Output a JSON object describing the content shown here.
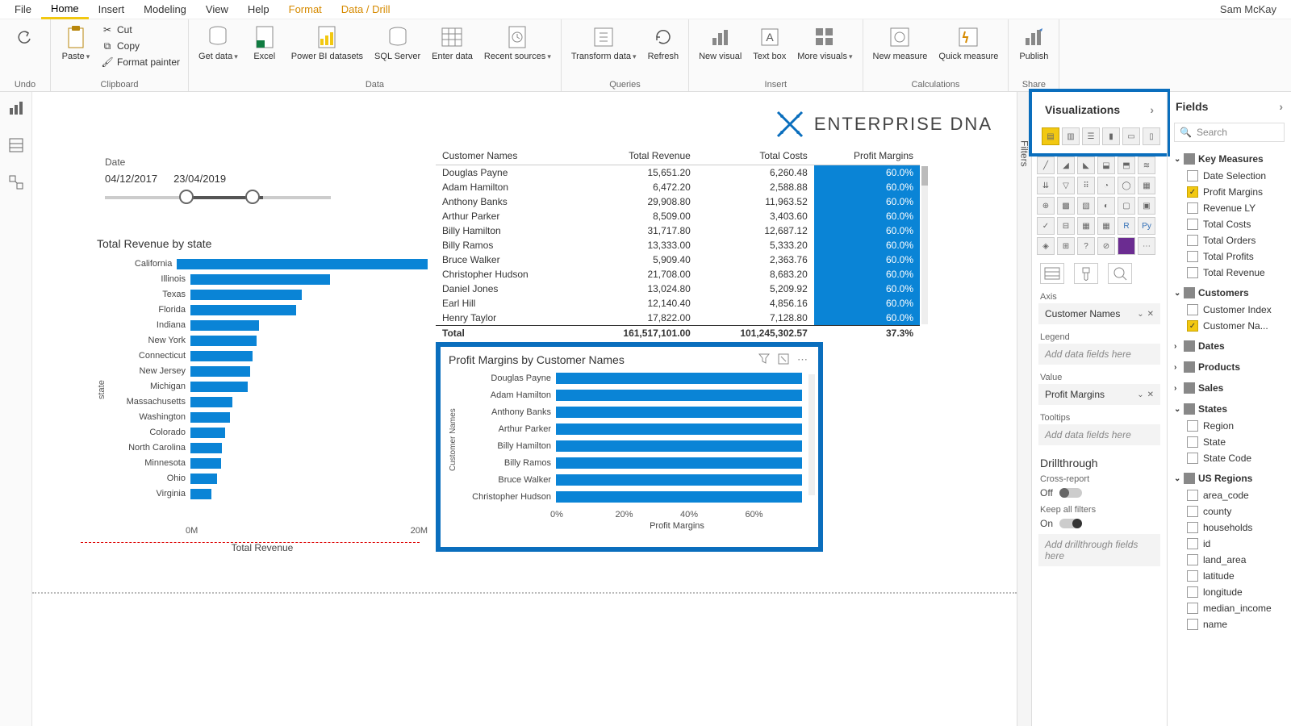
{
  "user": "Sam McKay",
  "menus": {
    "file": "File",
    "home": "Home",
    "insert": "Insert",
    "modeling": "Modeling",
    "view": "View",
    "help": "Help",
    "format": "Format",
    "datadrill": "Data / Drill"
  },
  "ribbon": {
    "undo": "Undo",
    "clipboard": {
      "paste": "Paste",
      "cut": "Cut",
      "copy": "Copy",
      "fp": "Format painter",
      "label": "Clipboard"
    },
    "data": {
      "getdata": "Get data",
      "excel": "Excel",
      "pbids": "Power BI datasets",
      "sql": "SQL Server",
      "enter": "Enter data",
      "recent": "Recent sources",
      "label": "Data"
    },
    "queries": {
      "transform": "Transform data",
      "refresh": "Refresh",
      "label": "Queries"
    },
    "insert": {
      "newvisual": "New visual",
      "textbox": "Text box",
      "more": "More visuals",
      "label": "Insert"
    },
    "calc": {
      "newmeasure": "New measure",
      "quick": "Quick measure",
      "label": "Calculations"
    },
    "share": {
      "publish": "Publish",
      "label": "Share"
    }
  },
  "logo": "ENTERPRISE DNA",
  "slicer": {
    "label": "Date",
    "from": "04/12/2017",
    "to": "23/04/2019"
  },
  "chart_data": [
    {
      "id": "state",
      "type": "bar",
      "orientation": "horizontal",
      "title": "Total Revenue by state",
      "xlabel": "Total Revenue",
      "ylabel": "state",
      "xticks": [
        "0M",
        "20M"
      ],
      "categories": [
        "California",
        "Illinois",
        "Texas",
        "Florida",
        "Indiana",
        "New York",
        "Connecticut",
        "New Jersey",
        "Michigan",
        "Massachusetts",
        "Washington",
        "Colorado",
        "North Carolina",
        "Minnesota",
        "Ohio",
        "Virginia"
      ],
      "values": [
        23.0,
        10.5,
        8.4,
        8.0,
        5.2,
        5.0,
        4.7,
        4.5,
        4.3,
        3.2,
        3.0,
        2.6,
        2.4,
        2.3,
        2.0,
        1.6
      ],
      "xmax": 24
    },
    {
      "id": "pm",
      "type": "bar",
      "orientation": "horizontal",
      "title": "Profit Margins by Customer Names",
      "xlabel": "Profit Margins",
      "ylabel": "Customer Names",
      "xticks": [
        "0%",
        "20%",
        "40%",
        "60%"
      ],
      "categories": [
        "Douglas Payne",
        "Adam Hamilton",
        "Anthony Banks",
        "Arthur Parker",
        "Billy Hamilton",
        "Billy Ramos",
        "Bruce Walker",
        "Christopher Hudson"
      ],
      "values": [
        60,
        60,
        60,
        60,
        60,
        60,
        60,
        60
      ],
      "xmax": 62
    }
  ],
  "table": {
    "cols": [
      "Customer Names",
      "Total Revenue",
      "Total Costs",
      "Profit Margins"
    ],
    "rows": [
      [
        "Douglas Payne",
        "15,651.20",
        "6,260.48",
        "60.0%"
      ],
      [
        "Adam Hamilton",
        "6,472.20",
        "2,588.88",
        "60.0%"
      ],
      [
        "Anthony Banks",
        "29,908.80",
        "11,963.52",
        "60.0%"
      ],
      [
        "Arthur Parker",
        "8,509.00",
        "3,403.60",
        "60.0%"
      ],
      [
        "Billy Hamilton",
        "31,717.80",
        "12,687.12",
        "60.0%"
      ],
      [
        "Billy Ramos",
        "13,333.00",
        "5,333.20",
        "60.0%"
      ],
      [
        "Bruce Walker",
        "5,909.40",
        "2,363.76",
        "60.0%"
      ],
      [
        "Christopher Hudson",
        "21,708.00",
        "8,683.20",
        "60.0%"
      ],
      [
        "Daniel Jones",
        "13,024.80",
        "5,209.92",
        "60.0%"
      ],
      [
        "Earl Hill",
        "12,140.40",
        "4,856.16",
        "60.0%"
      ],
      [
        "Henry Taylor",
        "17,822.00",
        "7,128.80",
        "60.0%"
      ]
    ],
    "total": [
      "Total",
      "161,517,101.00",
      "101,245,302.57",
      "37.3%"
    ]
  },
  "viz": {
    "hdr": "Visualizations",
    "axis": "Axis",
    "axis_val": "Customer Names",
    "legend": "Legend",
    "legend_ph": "Add data fields here",
    "value": "Value",
    "value_val": "Profit Margins",
    "tooltips": "Tooltips",
    "tooltips_ph": "Add data fields here",
    "drill": "Drillthrough",
    "cross": "Cross-report",
    "off": "Off",
    "keep": "Keep all filters",
    "on": "On",
    "drill_ph": "Add drillthrough fields here"
  },
  "fields": {
    "hdr": "Fields",
    "search": "Search",
    "groups": [
      {
        "name": "Key Measures",
        "open": true,
        "items": [
          {
            "n": "Date Selection",
            "c": false
          },
          {
            "n": "Profit Margins",
            "c": true
          },
          {
            "n": "Revenue LY",
            "c": false
          },
          {
            "n": "Total Costs",
            "c": false
          },
          {
            "n": "Total Orders",
            "c": false
          },
          {
            "n": "Total Profits",
            "c": false
          },
          {
            "n": "Total Revenue",
            "c": false
          }
        ]
      },
      {
        "name": "Customers",
        "open": true,
        "items": [
          {
            "n": "Customer Index",
            "c": false
          },
          {
            "n": "Customer Na...",
            "c": true
          }
        ]
      },
      {
        "name": "Dates",
        "open": false,
        "items": []
      },
      {
        "name": "Products",
        "open": false,
        "items": []
      },
      {
        "name": "Sales",
        "open": false,
        "items": []
      },
      {
        "name": "States",
        "open": true,
        "items": [
          {
            "n": "Region",
            "c": false
          },
          {
            "n": "State",
            "c": false
          },
          {
            "n": "State Code",
            "c": false
          }
        ]
      },
      {
        "name": "US Regions",
        "open": true,
        "items": [
          {
            "n": "area_code",
            "c": false
          },
          {
            "n": "county",
            "c": false
          },
          {
            "n": "households",
            "c": false
          },
          {
            "n": "id",
            "c": false
          },
          {
            "n": "land_area",
            "c": false
          },
          {
            "n": "latitude",
            "c": false
          },
          {
            "n": "longitude",
            "c": false
          },
          {
            "n": "median_income",
            "c": false
          },
          {
            "n": "name",
            "c": false
          }
        ]
      }
    ]
  },
  "filters_label": "Filters"
}
